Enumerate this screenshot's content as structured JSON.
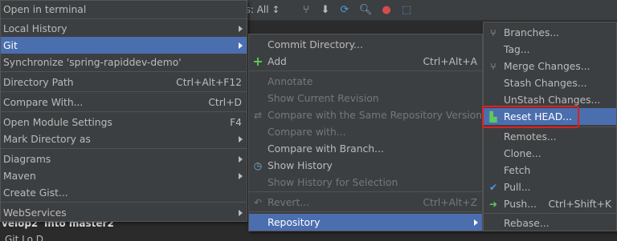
{
  "toolbar": {
    "branches_label": "hs: All ↕"
  },
  "log": {
    "line1": "velop2' into master2",
    "line2": "Git   Lo   D"
  },
  "context_menu": {
    "open_in_terminal": "Open in terminal",
    "local_history": "Local History",
    "git": "Git",
    "synchronize": "Synchronize 'spring-rapiddev-demo'",
    "directory_path": "Directory Path",
    "directory_path_sc": "Ctrl+Alt+F12",
    "compare_with": "Compare With...",
    "compare_with_sc": "Ctrl+D",
    "open_module_settings": "Open Module Settings",
    "open_module_settings_sc": "F4",
    "mark_directory_as": "Mark Directory as",
    "diagrams": "Diagrams",
    "maven": "Maven",
    "create_gist": "Create Gist...",
    "webservices": "WebServices"
  },
  "git_menu": {
    "commit_directory": "Commit Directory...",
    "add": "Add",
    "add_sc": "Ctrl+Alt+A",
    "annotate": "Annotate",
    "show_current_revision": "Show Current Revision",
    "compare_same_repo": "Compare with the Same Repository Version",
    "compare_with": "Compare with...",
    "compare_with_branch": "Compare with Branch...",
    "show_history": "Show History",
    "show_history_selection": "Show History for Selection",
    "revert": "Revert...",
    "revert_sc": "Ctrl+Alt+Z",
    "repository": "Repository"
  },
  "repo_menu": {
    "branches": "Branches...",
    "tag": "Tag...",
    "merge_changes": "Merge Changes...",
    "stash_changes": "Stash Changes...",
    "unstash_changes": "UnStash Changes...",
    "reset_head": "Reset HEAD...",
    "remotes": "Remotes...",
    "clone": "Clone...",
    "fetch": "Fetch",
    "pull": "Pull...",
    "push": "Push...",
    "push_sc": "Ctrl+Shift+K",
    "rebase": "Rebase..."
  }
}
